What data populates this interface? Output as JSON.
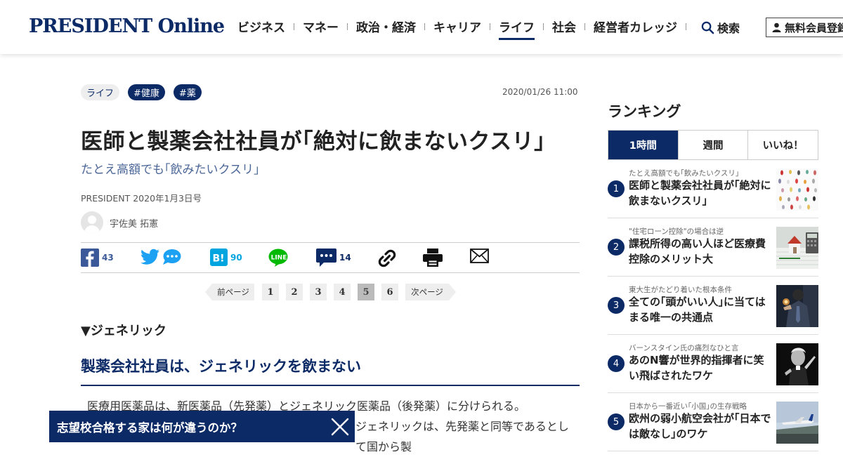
{
  "header": {
    "logo": "PRESIDENT Online",
    "nav": [
      "ビジネス",
      "マネー",
      "政治・経済",
      "キャリア",
      "ライフ",
      "社会",
      "経営者カレッジ"
    ],
    "active_nav": "ライフ",
    "search_label": "検索",
    "register_label": "無料会員登録"
  },
  "article": {
    "category": "ライフ",
    "tags": [
      "#健康",
      "#薬"
    ],
    "date": "2020/01/26 11:00",
    "title": "医師と製薬会社社員が｢絶対に飲まないクスリ｣",
    "subtitle": "たとえ高額でも｢飲みたいクスリ｣",
    "source": "PRESIDENT 2020年1月3日号",
    "author": "宇佐美 拓憲",
    "section_head": "▼ジェネリック",
    "h2": "製薬会社社員は、ジェネリックを飲まない",
    "body_line1": "医療用医薬品は、新医薬品（先発薬）とジェネリック医薬品（後発薬）に分けられる。",
    "body_line2": "ジェネリックは、先発薬と同等であるとして国から製"
  },
  "share": {
    "facebook_count": "43",
    "hatena_count": "90",
    "comment_count": "14"
  },
  "pager": {
    "prev_label": "前ページ",
    "next_label": "次ページ",
    "pages": [
      "1",
      "2",
      "3",
      "4",
      "5",
      "6"
    ],
    "current": "5"
  },
  "banner": {
    "text": "志望校合格する家は何が違うのか？"
  },
  "ranking": {
    "title": "ランキング",
    "tabs": [
      "1時間",
      "週間",
      "いいね！"
    ],
    "active_tab": "1時間",
    "items": [
      {
        "rank": "1",
        "sub": "たとえ高額でも｢飲みたいクスリ｣",
        "headline": "医師と製薬会社社員が｢絶対に飲まないクスリ｣"
      },
      {
        "rank": "2",
        "sub": "\"住宅ローン控除\"の場合は逆",
        "headline": "課税所得の高い人ほど医療費控除のメリット大"
      },
      {
        "rank": "3",
        "sub": "東大生がたどり着いた根本条件",
        "headline": "全ての｢頭がいい人｣に当てはまる唯一の共通点"
      },
      {
        "rank": "4",
        "sub": "バーンスタイン氏の痛烈なひと言",
        "headline": "あのN響が世界的指揮者に笑い飛ばされたワケ"
      },
      {
        "rank": "5",
        "sub": "日本から一番近い｢小国｣の生存戦略",
        "headline": "欧州の弱小航空会社が｢日本では敵なし｣のワケ"
      }
    ]
  },
  "colors": {
    "brand": "#0c2a66",
    "facebook": "#3b5998",
    "twitter": "#1da1f2",
    "hatena": "#00a4de",
    "line": "#00b900"
  }
}
